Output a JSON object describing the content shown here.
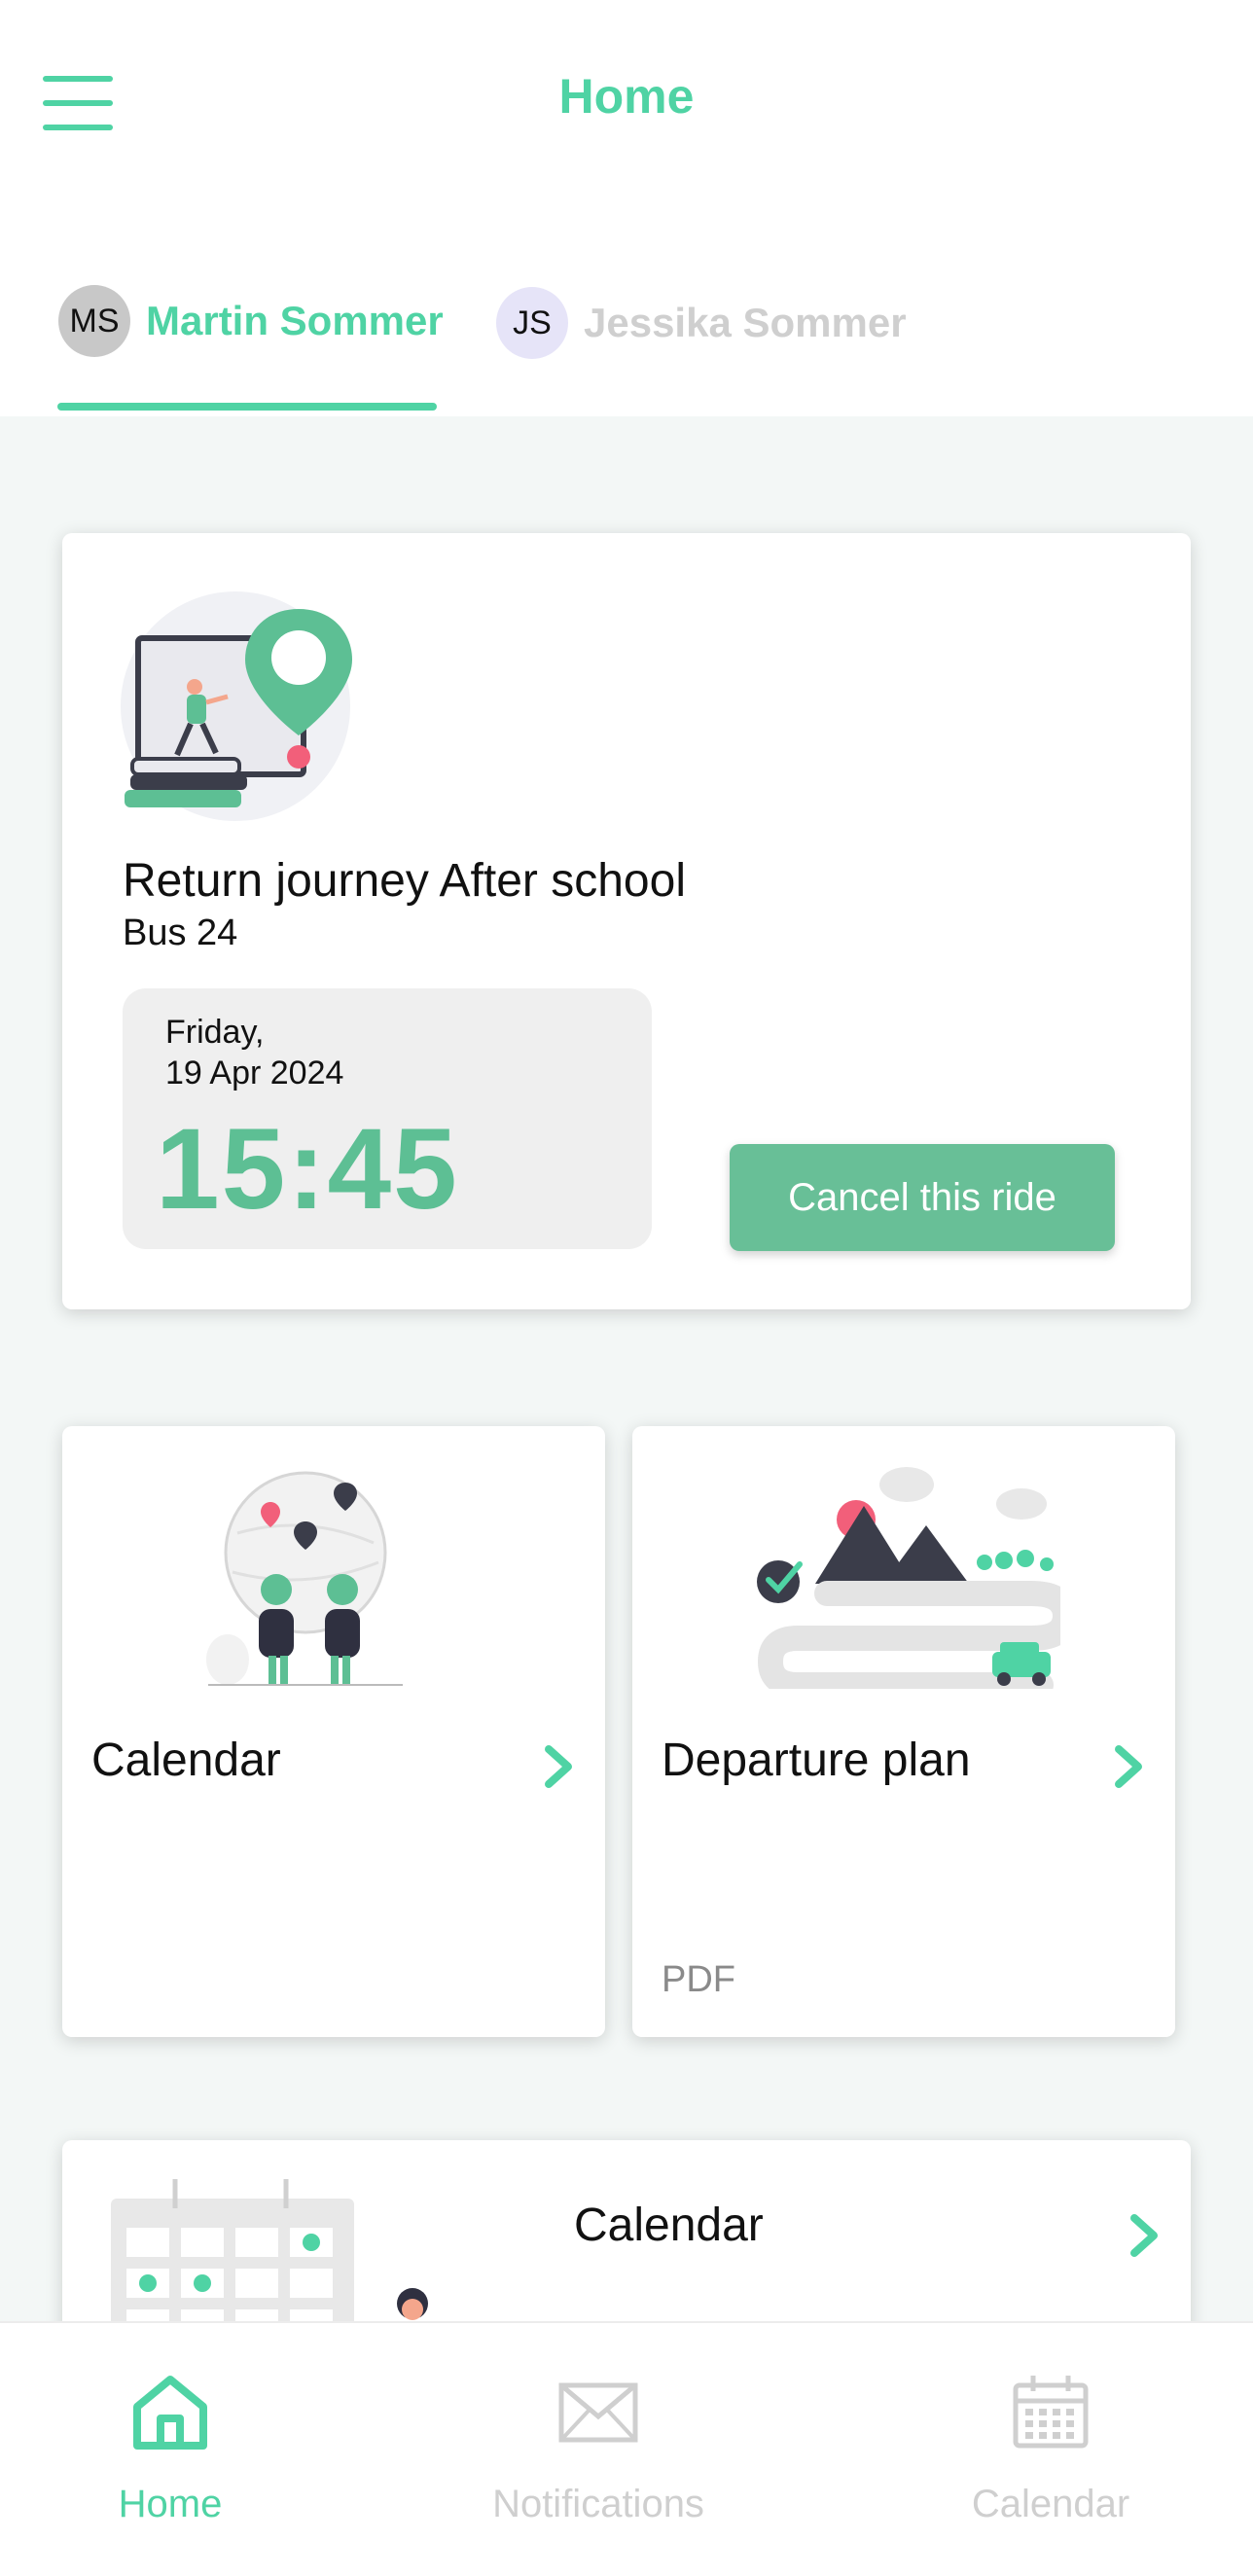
{
  "header": {
    "title": "Home",
    "menu_icon": "hamburger-menu-icon"
  },
  "children_tabs": [
    {
      "initials": "MS",
      "name": "Martin Sommer",
      "active": true
    },
    {
      "initials": "JS",
      "name": "Jessika Sommer",
      "active": false
    }
  ],
  "ride": {
    "title": "Return journey After school",
    "line": "Bus 24",
    "day": "Friday,",
    "date": "19 Apr 2024",
    "time": "15:45",
    "cancel_label": "Cancel this ride"
  },
  "tiles": [
    {
      "title": "Calendar",
      "footer": "",
      "icon": "chevron-right-icon"
    },
    {
      "title": "Departure plan",
      "footer": "PDF",
      "icon": "chevron-right-icon"
    }
  ],
  "wide_card": {
    "title": "Calendar",
    "icon": "chevron-right-icon"
  },
  "bottom_nav": [
    {
      "label": "Home",
      "icon": "home-icon",
      "active": true
    },
    {
      "label": "Notifications",
      "icon": "envelope-icon",
      "active": false
    },
    {
      "label": "Calendar",
      "icon": "calendar-icon",
      "active": false
    }
  ],
  "colors": {
    "accent": "#4fd3a4",
    "button": "#68bf97",
    "time": "#5dbf94",
    "inactive": "#cfcfcf",
    "background": "#f3f7f6"
  }
}
